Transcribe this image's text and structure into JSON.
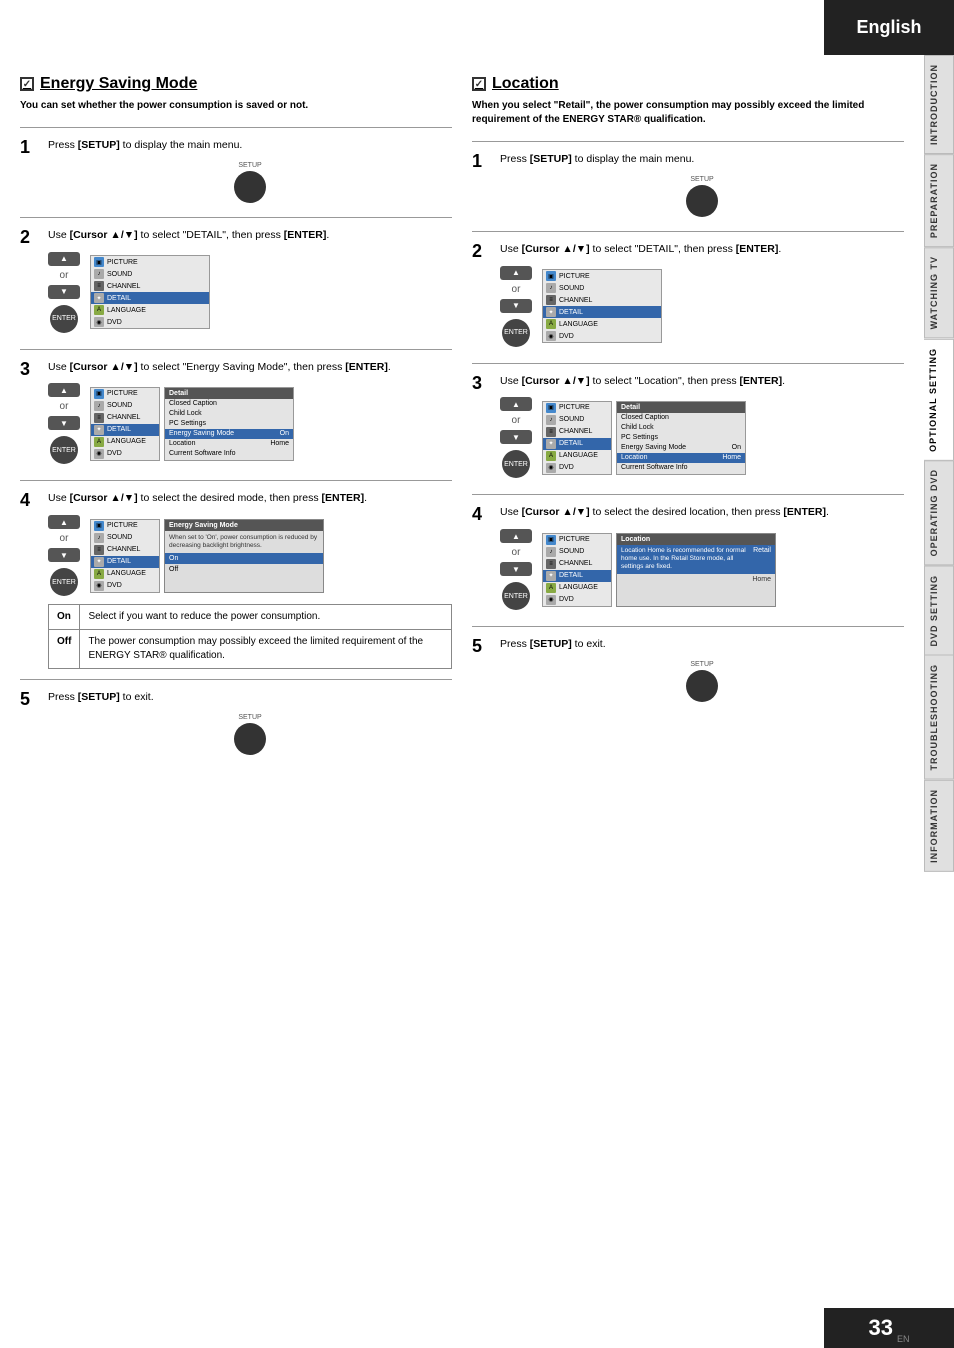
{
  "header": {
    "language": "English"
  },
  "page": {
    "number": "33",
    "en_label": "EN"
  },
  "side_tabs": [
    {
      "label": "INTRODUCTION",
      "active": false
    },
    {
      "label": "PREPARATION",
      "active": false
    },
    {
      "label": "WATCHING TV",
      "active": false
    },
    {
      "label": "OPTIONAL SETTING",
      "active": true
    },
    {
      "label": "OPERATING DVD",
      "active": false
    },
    {
      "label": "DVD SETTING",
      "active": false
    },
    {
      "label": "TROUBLESHOOTING",
      "active": false
    },
    {
      "label": "INFORMATION",
      "active": false
    }
  ],
  "left_section": {
    "title": "Energy Saving Mode",
    "subtitle": "You can set whether the power consumption is saved or not.",
    "steps": [
      {
        "number": "1",
        "text": "Press [SETUP] to display the main menu."
      },
      {
        "number": "2",
        "text": "Use [Cursor ▲/▼] to select \"DETAIL\", then press [ENTER]."
      },
      {
        "number": "3",
        "text": "Use [Cursor ▲/▼] to select \"Energy Saving Mode\", then press [ENTER]."
      },
      {
        "number": "4",
        "text": "Use [Cursor ▲/▼] to select the desired mode, then press [ENTER]."
      },
      {
        "number": "5",
        "text": "Press [SETUP] to exit."
      }
    ],
    "on_off_table": {
      "on_label": "On",
      "on_desc": "Select if you want to reduce the power consumption.",
      "off_label": "Off",
      "off_desc": "The power consumption may possibly exceed the limited requirement of the ENERGY STAR® qualification."
    }
  },
  "right_section": {
    "title": "Location",
    "subtitle": "When you select \"Retail\", the power consumption may possibly exceed the limited requirement of the ENERGY STAR® qualification.",
    "steps": [
      {
        "number": "1",
        "text": "Press [SETUP] to display the main menu."
      },
      {
        "number": "2",
        "text": "Use [Cursor ▲/▼] to select \"DETAIL\", then press [ENTER]."
      },
      {
        "number": "3",
        "text": "Use [Cursor ▲/▼] to select \"Location\", then press [ENTER]."
      },
      {
        "number": "4",
        "text": "Use [Cursor ▲/▼] to select the desired location, then press [ENTER]."
      },
      {
        "number": "5",
        "text": "Press [SETUP] to exit."
      }
    ]
  },
  "menus": {
    "main_menu_items": [
      "PICTURE",
      "SOUND",
      "CHANNEL",
      "DETAIL",
      "LANGUAGE",
      "DVD"
    ],
    "detail_menu_header": "Detail",
    "detail_menu_items": [
      "Closed Caption",
      "Child Lock",
      "PC Settings",
      "Energy Saving Mode",
      "Location",
      "Current Software Info"
    ],
    "esm_header": "Energy Saving Mode",
    "esm_desc": "When set to 'On', power consumption is reduced by decreasing backlight brightness.",
    "esm_on": "On",
    "esm_off": "Off",
    "loc_header": "Location",
    "loc_retail_label": "Retail",
    "loc_retail_desc": "Location Home is recommended for normal home use. In the Retail Store mode, all settings are fixed.",
    "loc_home_label": "Home"
  }
}
